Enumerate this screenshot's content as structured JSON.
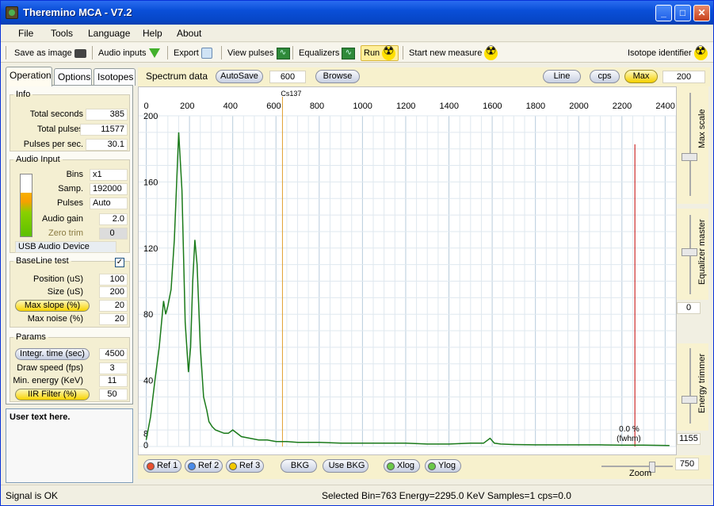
{
  "window": {
    "title": "Theremino MCA - V7.2",
    "min": "_",
    "max": "□",
    "close": "✕"
  },
  "menu": [
    "File",
    "Tools",
    "Language",
    "Help",
    "About"
  ],
  "toolbar": {
    "save_image": "Save as image",
    "audio_inputs": "Audio inputs",
    "export": "Export",
    "view_pulses": "View pulses",
    "equalizers": "Equalizers",
    "run": "Run",
    "start_new": "Start new measure",
    "isotope": "Isotope identifier"
  },
  "tabs": [
    "Operation",
    "Options",
    "Isotopes"
  ],
  "info": {
    "legend": "Info",
    "rows": [
      {
        "label": "Total seconds",
        "value": "385"
      },
      {
        "label": "Total pulses",
        "value": "11577"
      },
      {
        "label": "Pulses per sec.",
        "value": "30.1"
      }
    ]
  },
  "audio": {
    "legend": "Audio Input",
    "rows": [
      {
        "label": "Bins",
        "value": "x1"
      },
      {
        "label": "Samp.",
        "value": "192000"
      },
      {
        "label": "Pulses",
        "value": "Auto"
      },
      {
        "label": "Audio gain",
        "value": "2.0"
      },
      {
        "label": "Zero trim",
        "value": "0"
      }
    ],
    "device": "USB Audio Device",
    "level": 0.7
  },
  "baseline": {
    "legend": "BaseLine test",
    "checked": true,
    "rows": [
      {
        "label": "Position (uS)",
        "value": "100"
      },
      {
        "label": "Size (uS)",
        "value": "200"
      },
      {
        "label": "Max slope (%)",
        "value": "20"
      },
      {
        "label": "Max noise (%)",
        "value": "20"
      }
    ]
  },
  "params": {
    "legend": "Params",
    "rows": [
      {
        "label": "Integr. time (sec)",
        "value": "4500"
      },
      {
        "label": "Draw speed (fps)",
        "value": "3"
      },
      {
        "label": "Min. energy (KeV)",
        "value": "11"
      },
      {
        "label": "IIR Filter (%)",
        "value": "50"
      }
    ]
  },
  "notes": "User text here.",
  "spectrum_header": {
    "title": "Spectrum data",
    "autosave": "AutoSave",
    "autosave_val": "600",
    "browse": "Browse",
    "line": "Line",
    "cps": "cps",
    "max": "Max",
    "max_val": "200"
  },
  "right": {
    "max_scale": "Max scale",
    "eq_master": "Equalizer master",
    "eq_val": "0",
    "energy_trimmer": "Energy trimmer",
    "energy_val": "1155",
    "zoom_val": "750",
    "zoom": "Zoom"
  },
  "bottom": {
    "ref1": "Ref 1",
    "ref2": "Ref 2",
    "ref3": "Ref 3",
    "bkg": "BKG",
    "use_bkg": "Use BKG",
    "xlog": "Xlog",
    "ylog": "Ylog"
  },
  "status": {
    "signal": "Signal is OK",
    "info": "Selected Bin=763  Energy=2295.0 KeV  Samples=1  cps=0.0"
  },
  "chart_data": {
    "type": "line",
    "xticks": [
      0,
      200,
      400,
      600,
      800,
      1000,
      1200,
      1400,
      1600,
      1800,
      2000,
      2200,
      2400
    ],
    "yticks": [
      0,
      8,
      40,
      80,
      120,
      160,
      200
    ],
    "xlim": [
      -35,
      2450
    ],
    "ylim": [
      0,
      200
    ],
    "marker_label": "Cs137",
    "marker_x": 630,
    "cursor_x": 2260,
    "fwhm_value": "0.0 %",
    "fwhm_unit": "(fwhm)",
    "colors": {
      "line": "#1a7a1a",
      "marker": "#e0a030",
      "cursor": "#c00000"
    },
    "series": [
      {
        "x": [
          0,
          20,
          40,
          60,
          80,
          90,
          100,
          115,
          130,
          150,
          165,
          180,
          195,
          205,
          215,
          225,
          235,
          250,
          265,
          280,
          290,
          305,
          320,
          340,
          360,
          380,
          400,
          440,
          480,
          520,
          560,
          600,
          650,
          700,
          800,
          900,
          1000,
          1100,
          1200,
          1300,
          1400,
          1500,
          1560,
          1590,
          1610,
          1640,
          1700,
          1800,
          1900,
          2000,
          2100,
          2200,
          2300,
          2420
        ],
        "y": [
          4,
          18,
          40,
          60,
          88,
          80,
          85,
          95,
          125,
          190,
          155,
          75,
          45,
          60,
          100,
          125,
          110,
          60,
          30,
          22,
          15,
          12,
          10,
          9,
          8,
          8,
          10,
          6,
          5,
          4,
          4,
          3,
          3,
          2.5,
          2.5,
          2,
          2,
          2,
          2,
          1.5,
          1.5,
          2,
          2,
          5,
          2,
          1.5,
          1.2,
          1,
          1,
          1,
          1,
          0.8,
          0.8,
          0.6
        ]
      }
    ]
  }
}
